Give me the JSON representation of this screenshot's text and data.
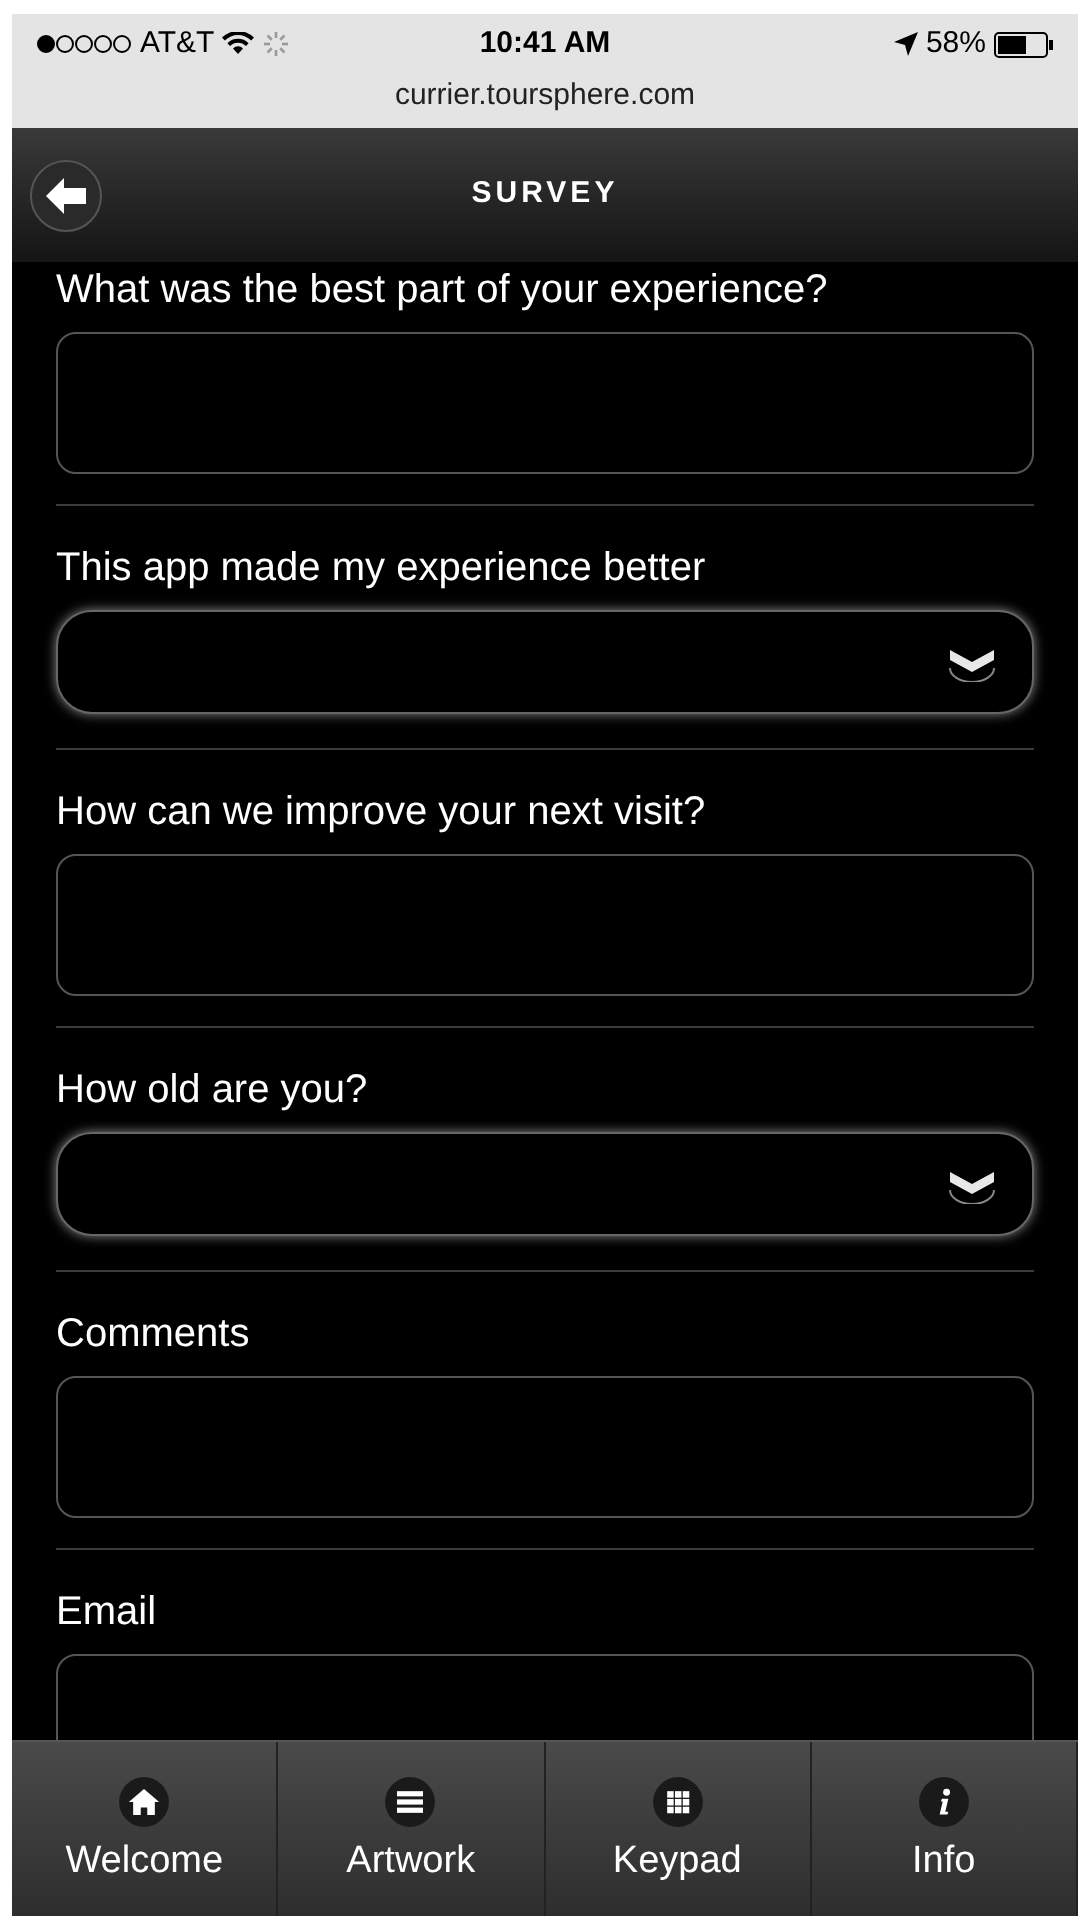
{
  "status_bar": {
    "carrier": "AT&T",
    "time": "10:41 AM",
    "battery": "58%"
  },
  "url": "currier.toursphere.com",
  "header": {
    "title": "SURVEY"
  },
  "questions": [
    {
      "label": "What was the best part of your experience?",
      "kind": "text"
    },
    {
      "label": "This app made my experience better",
      "kind": "select"
    },
    {
      "label": "How can we improve your next visit?",
      "kind": "text"
    },
    {
      "label": "How old are you?",
      "kind": "select"
    },
    {
      "label": "Comments",
      "kind": "text"
    },
    {
      "label": "Email",
      "kind": "text"
    }
  ],
  "tabs": [
    {
      "label": "Welcome",
      "kind": "home",
      "selected": false
    },
    {
      "label": "Artwork",
      "kind": "list",
      "selected": false
    },
    {
      "label": "Keypad",
      "kind": "grid",
      "selected": false
    },
    {
      "label": "Info",
      "kind": "info",
      "selected": false
    }
  ]
}
